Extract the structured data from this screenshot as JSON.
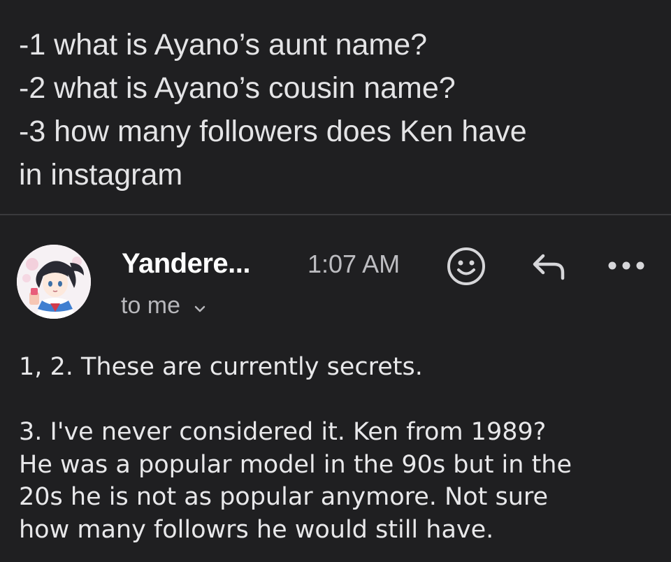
{
  "quoted_message": {
    "lines": [
      "-1 what is Ayano’s aunt name?",
      "-2 what is Ayano’s cousin name?",
      "-3 how many followers does Ken have",
      "in instagram"
    ]
  },
  "email": {
    "sender": "Yandere...",
    "time": "1:07 AM",
    "recipient": "to me",
    "icons": {
      "emoji": "smiley-face-icon",
      "reply": "reply-arrow-icon",
      "more": "more-dots-icon",
      "expand": "chevron-down-icon"
    }
  },
  "body": {
    "paragraph1": "1, 2. These are currently secrets.",
    "paragraph2_lines": [
      "3. I've never considered it. Ken from 1989?",
      "He was a popular model in the 90s but in the",
      "20s he is not as popular anymore. Not sure",
      "how many followrs he would still have."
    ]
  },
  "colors": {
    "background": "#1f1f21",
    "text": "#e6e6e8",
    "muted": "#b7b7bb",
    "divider": "#3a3a3d"
  }
}
